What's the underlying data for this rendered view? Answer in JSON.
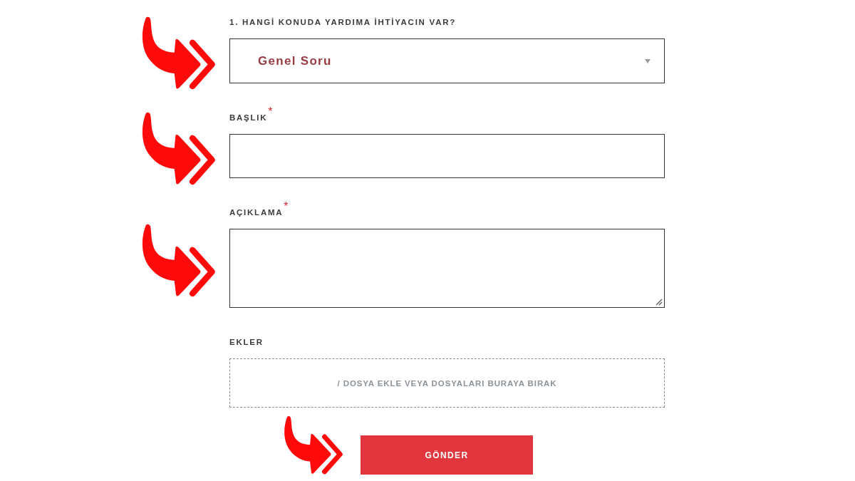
{
  "form": {
    "fields": [
      {
        "kind": "select",
        "label": "1. HANGİ KONUDA YARDIMA İHTİYACIN VAR?",
        "value": "Genel Soru",
        "arrow_marker": true
      },
      {
        "kind": "text",
        "label": "BAŞLIK",
        "required_mark": "*",
        "arrow_marker": true
      },
      {
        "kind": "textarea",
        "label": "AÇIKLAMA",
        "required_mark": "*",
        "arrow_marker": true
      },
      {
        "kind": "dropzone",
        "label": "EKLER",
        "prompt": "/ DOSYA EKLE VEYA DOSYALARI BURAYA BIRAK",
        "arrow_marker": false
      }
    ]
  },
  "submit_button": {
    "label": "GÖNDER",
    "arrow_marker": true
  }
}
